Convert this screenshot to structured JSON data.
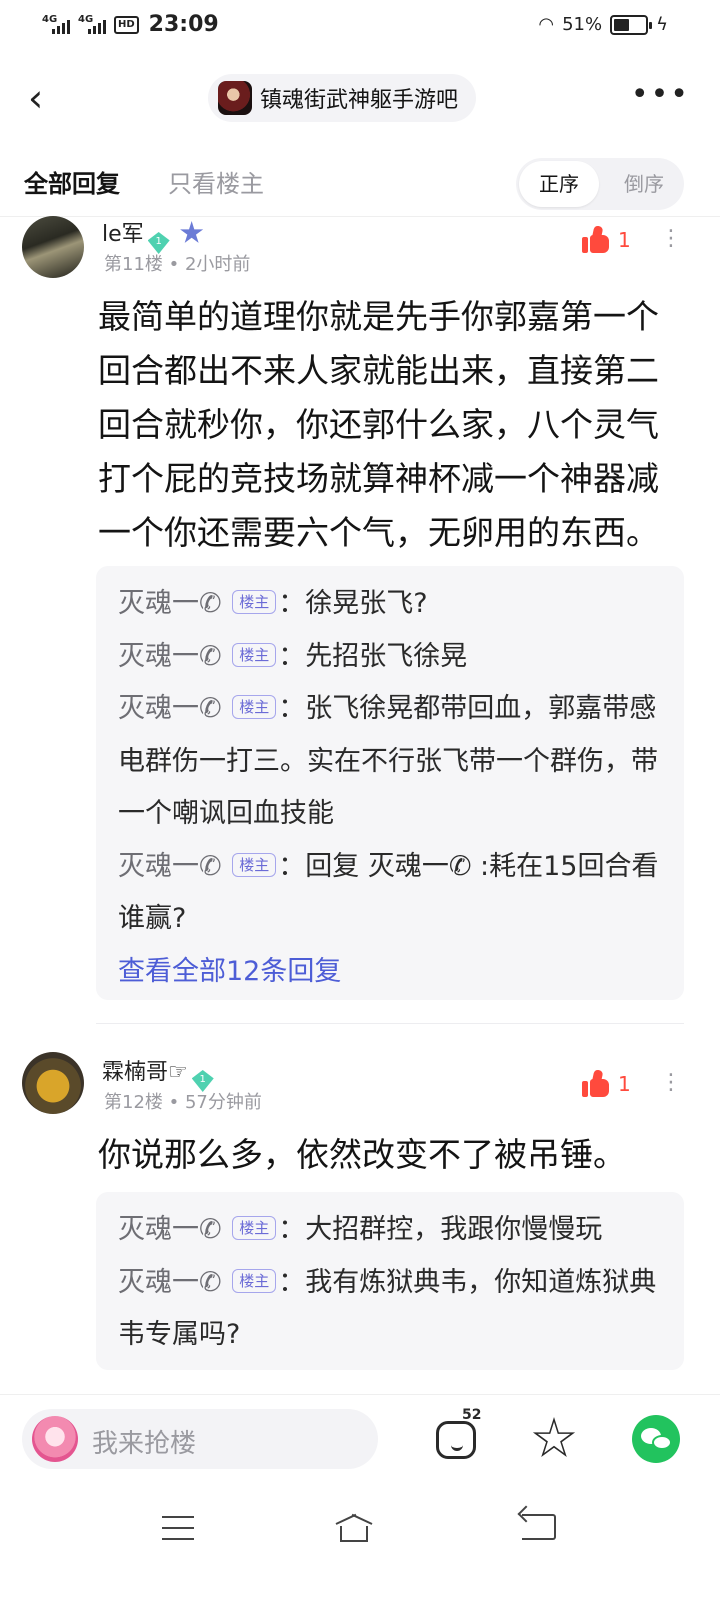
{
  "status_bar": {
    "network1": "4G",
    "network2": "4G",
    "hd": "HD",
    "time": "23:09",
    "battery": "51%",
    "battery_level": 0.51
  },
  "header": {
    "forum_name": "镇魂街武神躯手游吧"
  },
  "tabs": {
    "all_replies": "全部回复",
    "op_only": "只看楼主",
    "sort_asc": "正序",
    "sort_desc": "倒序"
  },
  "posts": [
    {
      "username": "le军",
      "level": "1",
      "floor_time": "第11楼 • 2小时前",
      "likes": "1",
      "content": "最简单的道理你就是先手你郭嘉第一个回合都出不来人家就能出来，直接第二回合就秒你，你还郭什么家，八个灵气打个屁的竞技场就算神杯减一个神器减一个你还需要六个气，无卵用的东西。",
      "replies": [
        {
          "author": "灭魂一✆",
          "tag": "楼主",
          "text": "徐晃张飞?"
        },
        {
          "author": "灭魂一✆",
          "tag": "楼主",
          "text": "先招张飞徐晃"
        },
        {
          "author": "灭魂一✆",
          "tag": "楼主",
          "text": "张飞徐晃都带回血，郭嘉带感电群伤一打三。实在不行张飞带一个群伤，带一个嘲讽回血技能"
        },
        {
          "author": "灭魂一✆",
          "tag": "楼主",
          "text": "回复 灭魂一✆ :耗在15回合看谁赢?"
        }
      ],
      "view_all": "查看全部12条回复"
    },
    {
      "username": "霖楠哥☞",
      "level": "1",
      "floor_time": "第12楼 • 57分钟前",
      "likes": "1",
      "content": "你说那么多，依然改变不了被吊锤。",
      "replies": [
        {
          "author": "灭魂一✆",
          "tag": "楼主",
          "text": "大招群控，我跟你慢慢玩"
        },
        {
          "author": "灭魂一✆",
          "tag": "楼主",
          "text": "我有炼狱典韦，你知道炼狱典韦专属吗?"
        }
      ]
    }
  ],
  "bottom_bar": {
    "input_placeholder": "我来抢楼",
    "comment_count": "52"
  },
  "icons": {
    "back": "chevron-left-icon",
    "more": "more-dots-icon",
    "like": "thumbs-up-icon",
    "comment": "comment-icon",
    "favorite": "star-icon",
    "share": "wechat-icon"
  },
  "colors": {
    "like_red": "#ff4a3d",
    "link_blue": "#4d5dd6",
    "op_tag": "#6b6bd6",
    "wechat_green": "#22c35e"
  }
}
